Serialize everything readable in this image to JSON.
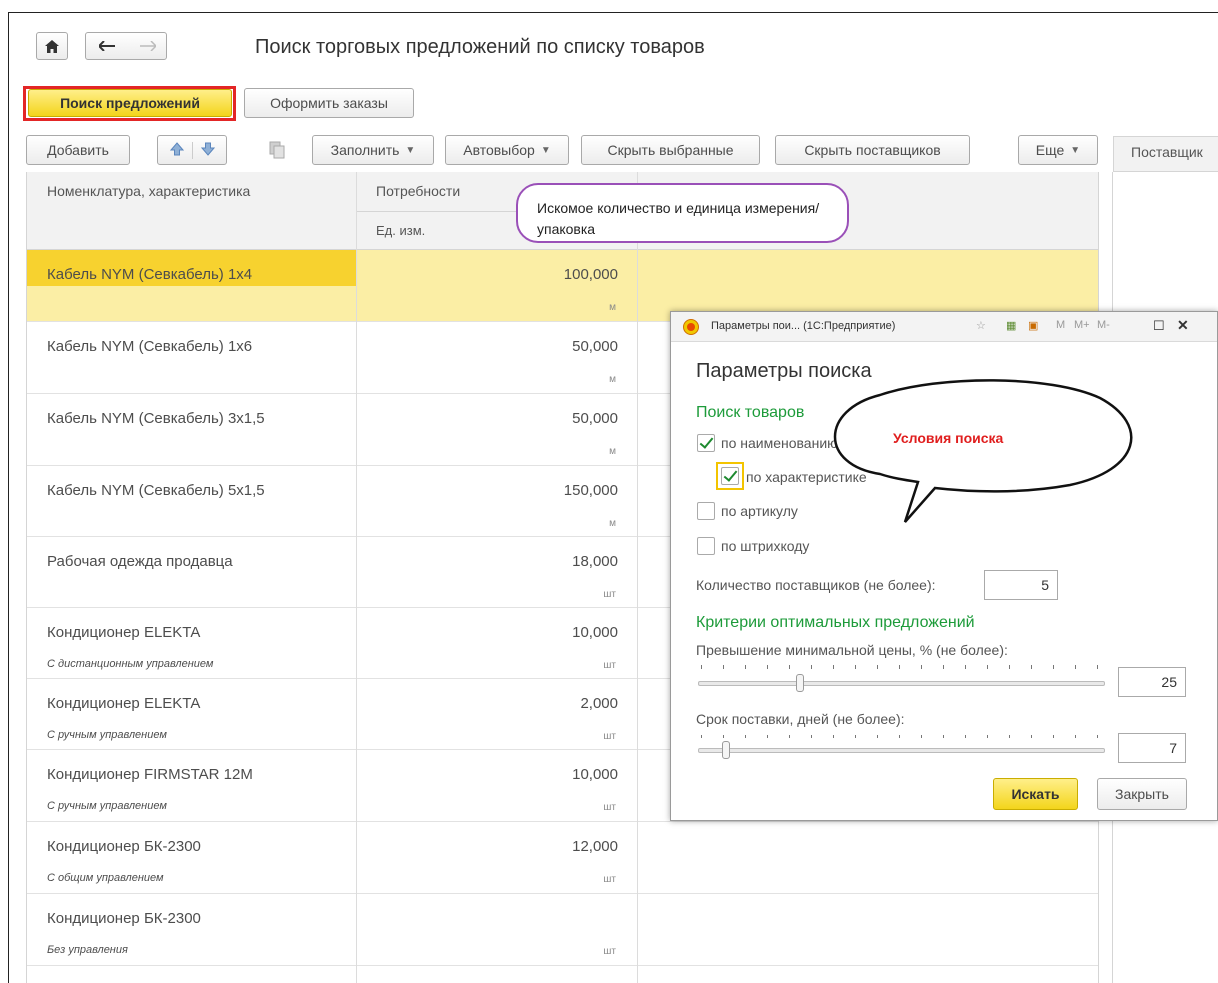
{
  "header": {
    "title": "Поиск торговых предложений по списку товаров",
    "search_offers": "Поиск предложений",
    "place_orders": "Оформить заказы"
  },
  "toolbar": {
    "add": "Добавить",
    "fill": "Заполнить",
    "autoselect": "Автовыбор",
    "hide_selected": "Скрыть выбранные",
    "hide_suppliers": "Скрыть поставщиков",
    "more": "Еще"
  },
  "right_panel": {
    "header": "Поставщик"
  },
  "table": {
    "col_name": "Номенклатура, характеристика",
    "col_needs": "Потребности",
    "col_unit": "Ед. изм.",
    "rows": [
      {
        "name": "Кабель NYM (Севкабель) 1х4",
        "qty": "100,000",
        "unit": "м",
        "char": ""
      },
      {
        "name": "Кабель NYM (Севкабель) 1х6",
        "qty": "50,000",
        "unit": "м",
        "char": ""
      },
      {
        "name": "Кабель NYM (Севкабель) 3х1,5",
        "qty": "50,000",
        "unit": "м",
        "char": ""
      },
      {
        "name": "Кабель NYM (Севкабель) 5х1,5",
        "qty": "150,000",
        "unit": "м",
        "char": ""
      },
      {
        "name": "Рабочая одежда продавца",
        "qty": "18,000",
        "unit": "шт",
        "char": ""
      },
      {
        "name": "Кондиционер ELEKTA",
        "qty": "10,000",
        "unit": "шт",
        "char": "С дистанционным управлением"
      },
      {
        "name": "Кондиционер ELEKTA",
        "qty": "2,000",
        "unit": "шт",
        "char": "С ручным управлением"
      },
      {
        "name": "Кондиционер FIRMSTAR 12M",
        "qty": "10,000",
        "unit": "шт",
        "char": "С ручным управлением"
      },
      {
        "name": "Кондиционер БК-2300",
        "qty": "12,000",
        "unit": "шт",
        "char": "С общим управлением"
      },
      {
        "name": "Кондиционер БК-2300",
        "qty": "",
        "unit": "шт",
        "char": "Без управления"
      }
    ]
  },
  "callout": {
    "text": "Искомое количество и единица измерения/упаковка"
  },
  "dialog": {
    "window_title": "Параметры пои... (1С:Предприятие)",
    "heading": "Параметры поиска",
    "section_goods": "Поиск товаров",
    "by_name": "по наименованию",
    "by_characteristic": "по характеристике",
    "by_article": "по артикулу",
    "by_barcode": "по штрихкоду",
    "supplier_count_label": "Количество поставщиков (не более):",
    "supplier_count": "5",
    "section_criteria": "Критерии оптимальных предложений",
    "price_excess_label": "Превышение минимальной цены, % (не более):",
    "price_excess": "25",
    "delivery_label": "Срок поставки, дней (не более):",
    "delivery_days": "7",
    "search_btn": "Искать",
    "close_btn": "Закрыть",
    "toolbar_m": "M",
    "toolbar_mplus": "M+",
    "toolbar_mminus": "M-"
  },
  "balloon": {
    "text": "Условия поиска"
  },
  "state": {
    "by_name_checked": true,
    "by_characteristic_checked": true,
    "by_article_checked": false,
    "by_barcode_checked": false,
    "price_slider_fraction": 0.25,
    "delivery_slider_fraction": 0.07,
    "selected_row": 0
  }
}
